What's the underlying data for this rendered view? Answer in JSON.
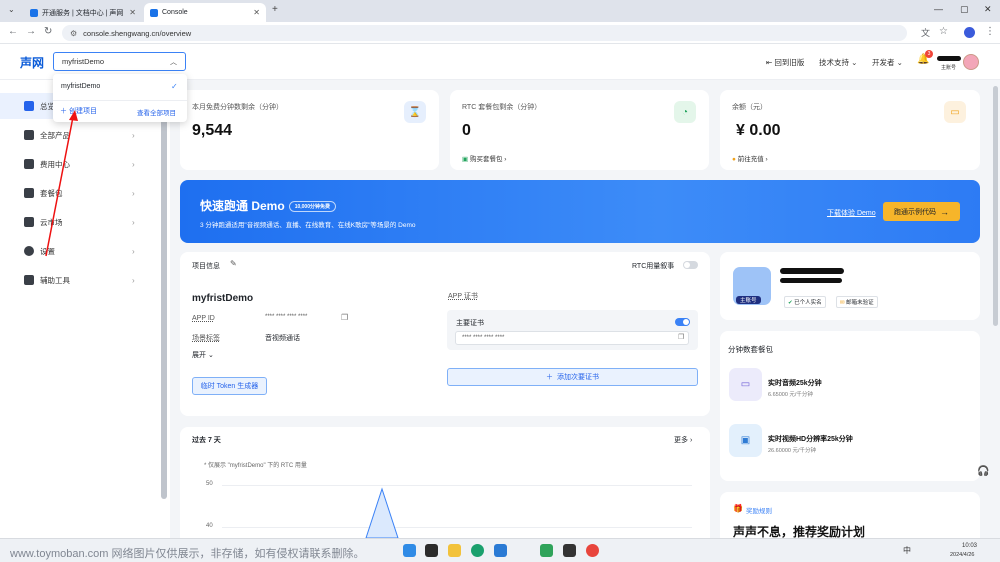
{
  "browser": {
    "tabs": [
      {
        "label": "开通服务 | 文档中心 | 声网"
      },
      {
        "label": "Console"
      }
    ],
    "url": "console.shengwang.cn/overview"
  },
  "header": {
    "logo": "声网",
    "project_select": "myfristDemo",
    "nav": [
      "回到旧版",
      "技术支持",
      "开发者"
    ],
    "notif_count": "3",
    "user_label": "主账号"
  },
  "dropdown": {
    "item": "myfristDemo",
    "create": "创建项目",
    "view_all": "查看全部项目"
  },
  "sidebar": {
    "items": [
      {
        "label": "总览"
      },
      {
        "label": "全部产品"
      },
      {
        "label": "费用中心"
      },
      {
        "label": "套餐包"
      },
      {
        "label": "云市场"
      },
      {
        "label": "设置"
      },
      {
        "label": "辅助工具"
      }
    ]
  },
  "stats": [
    {
      "label": "本月免费分钟数剩余（分钟）",
      "value": "9,544",
      "link": ""
    },
    {
      "label": "RTC 套餐包剩余（分钟）",
      "value": "0",
      "link": "购买套餐包"
    },
    {
      "label": "余额（元）",
      "value": "¥ 0.00",
      "link": "前往充值"
    }
  ],
  "banner": {
    "title": "快速跑通 Demo",
    "pill": "10,000分钟免费",
    "subtitle": "3 分钟跑通适用\"音视频通话、直播、在线教育、在线K歌房\"等场景的 Demo",
    "link": "下载体验 Demo",
    "button": "跑通示例代码"
  },
  "project": {
    "section": "项目信息",
    "rtc_switch": "RTC用量叙事",
    "name": "myfristDemo",
    "appid_label": "APP ID",
    "appid_value": "**** **** **** ****",
    "scene_label": "场景标签",
    "scene_value": "音视频通话",
    "expand": "展开",
    "token_btn": "临时 Token 生成器",
    "cert_title": "APP 证书",
    "cert_main": "主要证书",
    "cert_value": "**** **** **** ****",
    "add_cert": "添加次要证书"
  },
  "usage": {
    "title": "过去 7 天",
    "more": "更多",
    "note": "* 仅展示 \"myfristDemo\" 下的 RTC 用量",
    "ticks": [
      "50",
      "40"
    ]
  },
  "profile": {
    "badge": "主账号",
    "verified": "已个人实名",
    "email": "邮箱未验证"
  },
  "packages": {
    "title": "分钟数套餐包",
    "items": [
      {
        "name": "实时音频25k分钟",
        "price": "6.65000 元/千分钟"
      },
      {
        "name": "实时视频HD分辨率25k分钟",
        "price": "26.60000 元/千分钟"
      }
    ]
  },
  "rewards": {
    "tag": "奖励规则",
    "title": "声声不息，推荐奖励计划"
  },
  "taskbar": {
    "time": "10:03",
    "date": "2024/4/26",
    "lang": "中"
  },
  "watermark": "www.toymoban.com 网络图片仅供展示，非存储，如有侵权请联系删除。"
}
